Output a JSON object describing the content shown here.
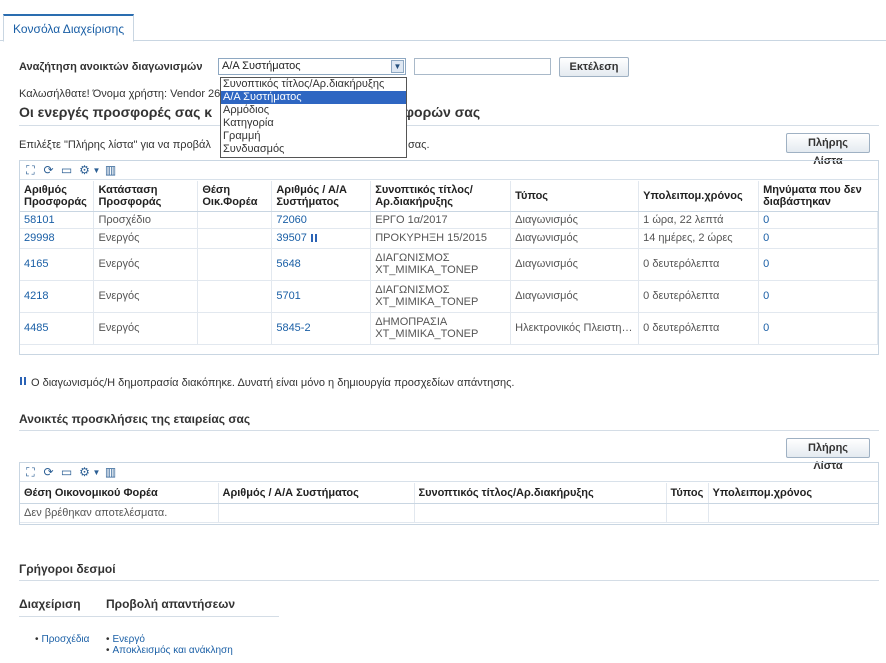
{
  "tab": {
    "label": "Κονσόλα Διαχείρισης"
  },
  "search": {
    "label": "Αναζήτηση ανοικτών διαγωνισμών",
    "selected": "Α/Α Συστήματος",
    "run_label": "Εκτέλεση",
    "options": [
      "Συνοπτικός τίτλος/Αρ.διακήρυξης",
      "Α/Α Συστήματος",
      "Αρμόδιος",
      "Κατηγορία",
      "Γραμμή",
      "Συνδυασμός"
    ]
  },
  "welcome": "Καλωσήλθατε! Όνομα χρήστη: Vendor 26",
  "offers": {
    "heading_a": "Οι ενεργές προσφορές σας κ",
    "heading_b": "φορών σας",
    "instructions_a": "Επιλέξτε \"Πλήρης λίστα\" για να προβάλ",
    "instructions_b": "σας.",
    "full_list_label": "Πλήρης Λίστα",
    "columns": [
      "Αριθμός Προσφοράς",
      "Κατάσταση Προσφοράς",
      "Θέση Οικ.Φορέα",
      "Αριθμός / Α/Α Συστήματος",
      "Συνοπτικός τίτλος/Αρ.διακήρυξης",
      "Τύπος",
      "Υπολειπομ.χρόνος",
      "Μηνύματα που δεν διαβάστηκαν"
    ],
    "rows": [
      {
        "num": "58101",
        "status": "Προσχέδιο",
        "pos": "",
        "sys": "72060",
        "paused": false,
        "title": [
          "ΕΡΓΟ 1α/2017"
        ],
        "type": "Διαγωνισμός",
        "remaining": "1 ώρα, 22 λεπτά",
        "unread": "0"
      },
      {
        "num": "29998",
        "status": "Ενεργός",
        "pos": "",
        "sys": "39507",
        "paused": true,
        "title": [
          "ΠΡΟΚΥΡΗΞΗ 15/2015"
        ],
        "type": "Διαγωνισμός",
        "remaining": "14 ημέρες, 2 ώρες",
        "unread": "0"
      },
      {
        "num": "4165",
        "status": "Ενεργός",
        "pos": "",
        "sys": "5648",
        "paused": false,
        "title": [
          "ΔΙΑΓΩΝΙΣΜΟΣ",
          "ΧΤ_ΜΙΜΙΚΑ_ΤΟΝΕΡ"
        ],
        "type": "Διαγωνισμός",
        "remaining": "0 δευτερόλεπτα",
        "unread": "0"
      },
      {
        "num": "4218",
        "status": "Ενεργός",
        "pos": "",
        "sys": "5701",
        "paused": false,
        "title": [
          "ΔΙΑΓΩΝΙΣΜΟΣ",
          "ΧΤ_ΜΙΜΙΚΑ_ΤΟΝΕΡ"
        ],
        "type": "Διαγωνισμός",
        "remaining": "0 δευτερόλεπτα",
        "unread": "0"
      },
      {
        "num": "4485",
        "status": "Ενεργός",
        "pos": "",
        "sys": "5845-2",
        "paused": false,
        "title": [
          "ΔΗΜΟΠΡΑΣΙΑ",
          "ΧΤ_ΜΙΜΙΚΑ_ΤΟΝΕΡ"
        ],
        "type": "Ηλεκτρονικός Πλειστη…",
        "remaining": "0 δευτερόλεπτα",
        "unread": "0"
      }
    ],
    "note": "Ο διαγωνισμός/Η δημοπρασία διακόπηκε. Δυνατή είναι μόνο η δημιουργία προσχεδίων απάντησης."
  },
  "invitations": {
    "heading": "Ανοικτές προσκλήσεις της εταιρείας σας",
    "full_list_label": "Πλήρης Λίστα",
    "columns": [
      "Θέση Οικονομικού Φορέα",
      "Αριθμός / Α/Α Συστήματος",
      "Συνοπτικός τίτλος/Αρ.διακήρυξης",
      "Τύπος",
      "Υπολειπομ.χρόνος"
    ],
    "empty": "Δεν βρέθηκαν αποτελέσματα."
  },
  "quick_links": {
    "heading": "Γρήγοροι δεσμοί",
    "col1_heading": "Διαχείριση",
    "col2_heading": "Προβολή απαντήσεων",
    "col1_items": [
      "Προσχέδια"
    ],
    "col2_items": [
      "Ενεργό",
      "Αποκλεισμός και ανάκληση"
    ]
  },
  "icons": [
    "detach-icon",
    "refresh-icon",
    "export-icon",
    "settings-icon",
    "columns-icon"
  ],
  "colors": {
    "link": "#1a5fa6",
    "tab_accent": "#2a6db0",
    "selected_option": "#2e66c2"
  }
}
